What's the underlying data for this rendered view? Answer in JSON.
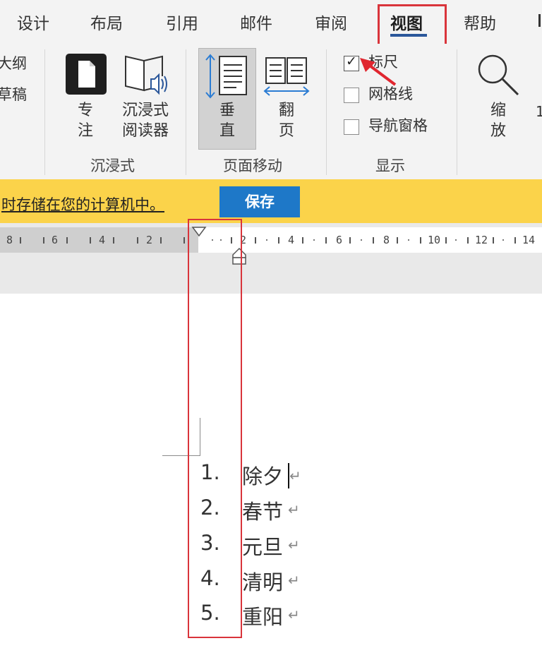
{
  "tabs": [
    "设计",
    "布局",
    "引用",
    "邮件",
    "审阅",
    "视图",
    "帮助"
  ],
  "active_tab": "视图",
  "ribbon": {
    "partial_left": [
      "大纲",
      "草稿"
    ],
    "focus_label": [
      "专",
      "注"
    ],
    "reader_label": [
      "沉浸式",
      "阅读器"
    ],
    "vertical_label": [
      "垂",
      "直"
    ],
    "flip_label": [
      "翻",
      "页"
    ],
    "zoom_label": [
      "缩",
      "放"
    ],
    "group_immersive": "沉浸式",
    "group_page_movement": "页面移动",
    "group_show": "显示",
    "checkboxes": [
      {
        "label": "标尺",
        "checked": true
      },
      {
        "label": "网格线",
        "checked": false
      },
      {
        "label": "导航窗格",
        "checked": false
      }
    ]
  },
  "message_bar": {
    "text": "时存储在您的计算机中。",
    "save_label": "保存",
    "accent": "#fbd34a",
    "button_color": "#1e78c8"
  },
  "ruler": {
    "left_labels": [
      "8",
      "6",
      "4",
      "2"
    ],
    "right_labels": [
      "2",
      "4",
      "6",
      "8",
      "10",
      "12",
      "14"
    ]
  },
  "document": {
    "list_numbers": [
      "1.",
      "2.",
      "3.",
      "4.",
      "5."
    ],
    "list_items": [
      "除夕",
      "春节",
      "元旦",
      "清明",
      "重阳"
    ],
    "paragraph_mark": "↵"
  },
  "highlight_color": "#d9343b",
  "icons": [
    "focus-icon",
    "immersive-reader-icon",
    "vertical-scroll-icon",
    "side-to-side-icon",
    "zoom-icon",
    "red-arrow-annotation"
  ]
}
